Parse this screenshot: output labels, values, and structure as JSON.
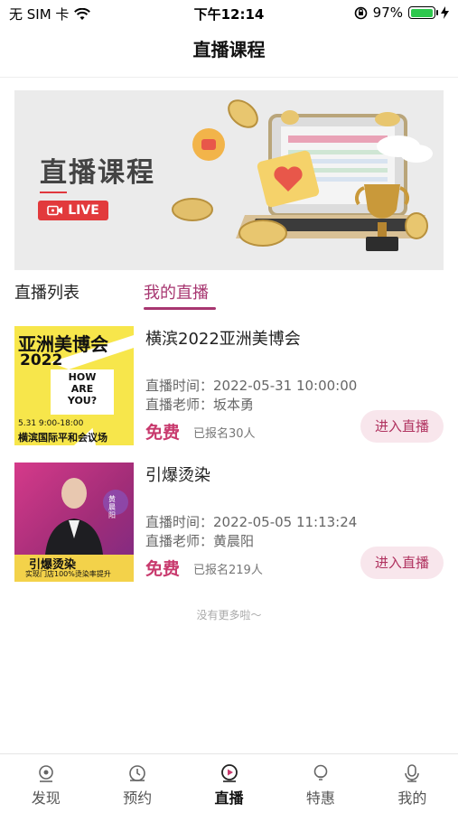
{
  "status_bar": {
    "carrier": "无 SIM 卡",
    "time": "下午12:14",
    "battery": "97%",
    "battery_level": 0.97
  },
  "header": {
    "title": "直播课程"
  },
  "banner": {
    "title": "直播课程",
    "live_label": "LIVE"
  },
  "tabs": [
    {
      "label": "直播列表",
      "active": false
    },
    {
      "label": "我的直播",
      "active": true
    }
  ],
  "courses": [
    {
      "title": "横滨2022亚洲美博会",
      "time_label": "直播时间：",
      "time": "2022-05-31 10:00:00",
      "teacher_label": "直播老师：",
      "teacher": "坂本勇",
      "price": "免费",
      "enrolled": "已报名30人",
      "button": "进入直播",
      "thumb": {
        "title": "亚洲美博会",
        "year": "2022",
        "slogan": "HOW ARE YOU?",
        "date": "5.31 9:00-18:00",
        "venue": "横滨国际平和会议场"
      }
    },
    {
      "title": "引爆烫染",
      "time_label": "直播时间：",
      "time": "2022-05-05 11:13:24",
      "teacher_label": "直播老师：",
      "teacher": "黄晨阳",
      "price": "免费",
      "enrolled": "已报名219人",
      "button": "进入直播",
      "thumb": {
        "title": "引爆烫染",
        "subtitle": "实现门店100%烫染率提升",
        "name": "黄晨阳"
      }
    }
  ],
  "no_more": "没有更多啦～",
  "tabbar": [
    {
      "label": "发现",
      "icon": "discover-icon",
      "active": false
    },
    {
      "label": "预约",
      "icon": "clock-icon",
      "active": false
    },
    {
      "label": "直播",
      "icon": "live-play-icon",
      "active": true
    },
    {
      "label": "特惠",
      "icon": "bulb-icon",
      "active": false
    },
    {
      "label": "我的",
      "icon": "mic-icon",
      "active": false
    }
  ],
  "colors": {
    "accent": "#a73670",
    "price": "#c8396d",
    "button_bg": "#f8e6ec",
    "live_red": "#e23a3c"
  }
}
